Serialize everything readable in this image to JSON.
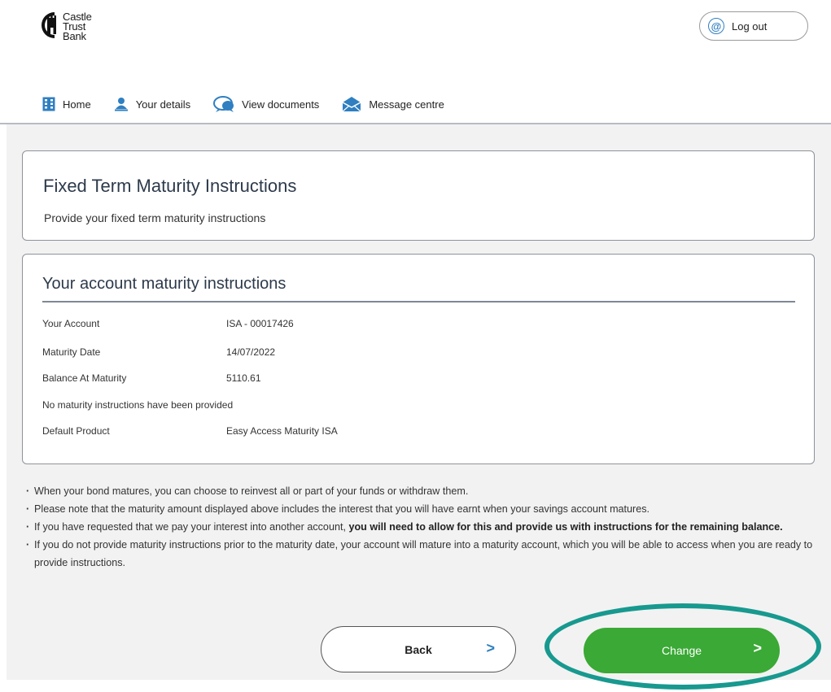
{
  "brand": {
    "line1": "Castle",
    "line2": "Trust",
    "line3": "Bank"
  },
  "header": {
    "logout_label": "Log out"
  },
  "nav": {
    "items": [
      {
        "label": "Home",
        "icon": "home-grid-icon"
      },
      {
        "label": "Your details",
        "icon": "person-icon"
      },
      {
        "label": "View documents",
        "icon": "documents-icon"
      },
      {
        "label": "Message centre",
        "icon": "envelope-icon"
      }
    ]
  },
  "intro_card": {
    "title": "Fixed Term Maturity Instructions",
    "subtitle": "Provide your fixed term maturity instructions"
  },
  "account_card": {
    "title": "Your account maturity instructions",
    "rows": [
      {
        "label": "Your Account",
        "value": "ISA - 00017426"
      },
      {
        "label": "Maturity Date",
        "value": "14/07/2022"
      },
      {
        "label": "Balance At Maturity",
        "value": "5110.61"
      },
      {
        "label": "No maturity instructions have been provided",
        "value": ""
      },
      {
        "label": "Default Product",
        "value": "Easy Access Maturity ISA"
      }
    ]
  },
  "notes": {
    "n1": "When your bond matures, you can choose to reinvest all or part of your funds or withdraw them.",
    "n2": "Please note that the maturity amount displayed above includes the interest that you will have earnt when your savings account matures.",
    "n3_plain": "If you have requested that we pay your interest into another account, ",
    "n3_bold": "you will need to allow for this and provide us with instructions for the remaining balance.",
    "n4": "If you do not provide maturity instructions prior to the maturity date, your account will mature into a maturity account, which you will be able to access when you are ready to provide instructions."
  },
  "actions": {
    "back_label": "Back",
    "change_label": "Change",
    "chevron": ">"
  },
  "colors": {
    "accent_blue": "#2f7fc1",
    "change_green": "#3aa935",
    "highlight_teal": "#18998f",
    "title_navy": "#2d3a4b"
  }
}
